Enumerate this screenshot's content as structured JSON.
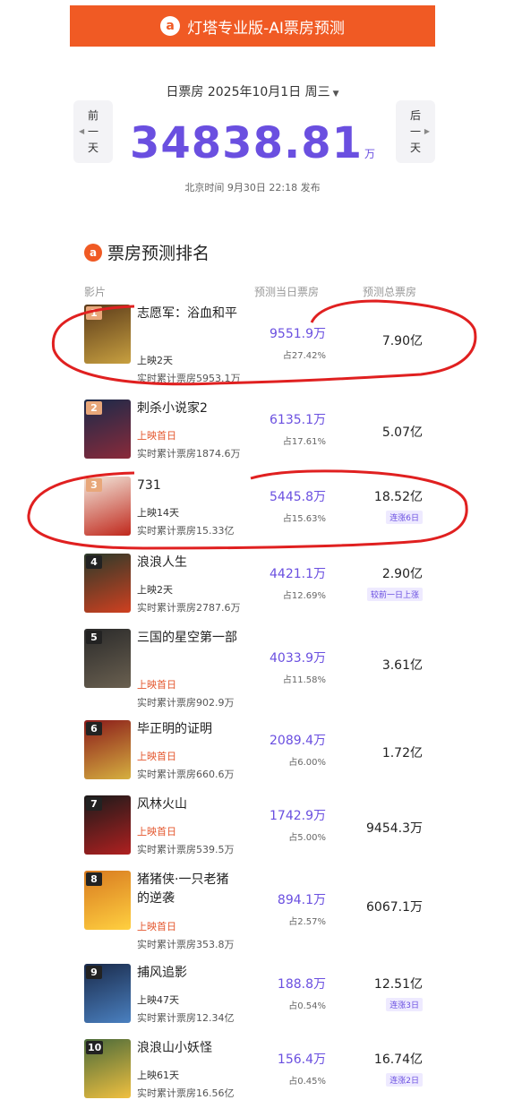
{
  "banner": {
    "logo": "a",
    "title": "灯塔专业版-AI票房预测"
  },
  "header": {
    "date_label": "日票房 2025年10月1日 周三",
    "prev": [
      "前",
      "一",
      "天"
    ],
    "next": [
      "后",
      "一",
      "天"
    ],
    "total_value": "34838.81",
    "total_unit": "万",
    "published": "北京时间 9月30日 22:18 发布"
  },
  "section": {
    "logo": "a",
    "title": "票房预测排名"
  },
  "columns": {
    "film": "影片",
    "day": "预测当日票房",
    "total": "预测总票房"
  },
  "colors": {
    "accent": "#f05a24",
    "purple": "#6a4fe0",
    "annotation": "#e02020"
  },
  "movies": [
    {
      "rank": "1",
      "title": "志愿军：浴血和平",
      "days": "上映2天",
      "cum": "实时累计票房5953.1万",
      "day": "9551.9万",
      "share": "占27.42%",
      "total": "7.90亿",
      "tag": ""
    },
    {
      "rank": "2",
      "title": "刺杀小说家2",
      "days": "上映首日",
      "cum": "实时累计票房1874.6万",
      "day": "6135.1万",
      "share": "占17.61%",
      "total": "5.07亿",
      "tag": ""
    },
    {
      "rank": "3",
      "title": "731",
      "days": "上映14天",
      "cum": "实时累计票房15.33亿",
      "day": "5445.8万",
      "share": "占15.63%",
      "total": "18.52亿",
      "tag": "连涨6日"
    },
    {
      "rank": "4",
      "title": "浪浪人生",
      "days": "上映2天",
      "cum": "实时累计票房2787.6万",
      "day": "4421.1万",
      "share": "占12.69%",
      "total": "2.90亿",
      "tag": "较前一日上涨"
    },
    {
      "rank": "5",
      "title": "三国的星空第一部",
      "days": "上映首日",
      "cum": "实时累计票房902.9万",
      "day": "4033.9万",
      "share": "占11.58%",
      "total": "3.61亿",
      "tag": ""
    },
    {
      "rank": "6",
      "title": "毕正明的证明",
      "days": "上映首日",
      "cum": "实时累计票房660.6万",
      "day": "2089.4万",
      "share": "占6.00%",
      "total": "1.72亿",
      "tag": ""
    },
    {
      "rank": "7",
      "title": "风林火山",
      "days": "上映首日",
      "cum": "实时累计票房539.5万",
      "day": "1742.9万",
      "share": "占5.00%",
      "total": "9454.3万",
      "tag": ""
    },
    {
      "rank": "8",
      "title": "猪猪侠·一只老猪的逆袭",
      "days": "上映首日",
      "cum": "实时累计票房353.8万",
      "day": "894.1万",
      "share": "占2.57%",
      "total": "6067.1万",
      "tag": ""
    },
    {
      "rank": "9",
      "title": "捕风追影",
      "days": "上映47天",
      "cum": "实时累计票房12.34亿",
      "day": "188.8万",
      "share": "占0.54%",
      "total": "12.51亿",
      "tag": "连涨3日"
    },
    {
      "rank": "10",
      "title": "浪浪山小妖怪",
      "days": "上映61天",
      "cum": "实时累计票房16.56亿",
      "day": "156.4万",
      "share": "占0.45%",
      "total": "16.74亿",
      "tag": "连涨2日"
    }
  ]
}
